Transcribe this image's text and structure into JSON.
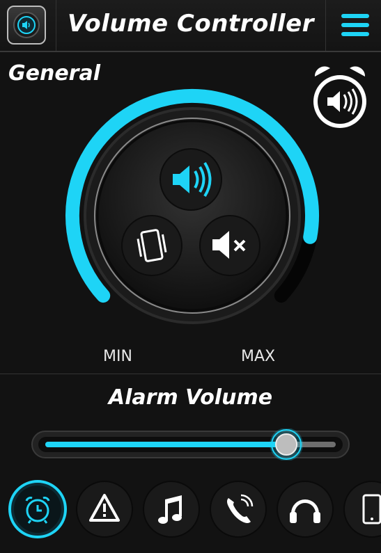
{
  "header": {
    "title": "Volume Controller",
    "app_icon": "speaker-app-icon",
    "menu_icon": "hamburger-menu-icon"
  },
  "section": {
    "label": "General",
    "alarm_toggle_icon": "alarm-speaker-icon"
  },
  "dial": {
    "level": 0.88,
    "min_label": "MIN",
    "max_label": "MAX",
    "modes": [
      {
        "name": "sound",
        "icon": "speaker-icon",
        "active": true
      },
      {
        "name": "vibrate",
        "icon": "vibrate-icon",
        "active": false
      },
      {
        "name": "mute",
        "icon": "mute-icon",
        "active": false
      }
    ]
  },
  "volume": {
    "label": "Alarm Volume",
    "level": 0.83
  },
  "tabs": [
    {
      "name": "alarm",
      "icon": "alarm-clock-icon",
      "active": true
    },
    {
      "name": "notification",
      "icon": "warning-icon",
      "active": false
    },
    {
      "name": "music",
      "icon": "music-note-icon",
      "active": false
    },
    {
      "name": "call",
      "icon": "phone-icon",
      "active": false
    },
    {
      "name": "headphones",
      "icon": "headphones-icon",
      "active": false
    },
    {
      "name": "system",
      "icon": "phone-device-icon",
      "active": false
    }
  ],
  "colors": {
    "accent": "#1ed4f6",
    "background": "#121212",
    "text": "#ffffff"
  }
}
